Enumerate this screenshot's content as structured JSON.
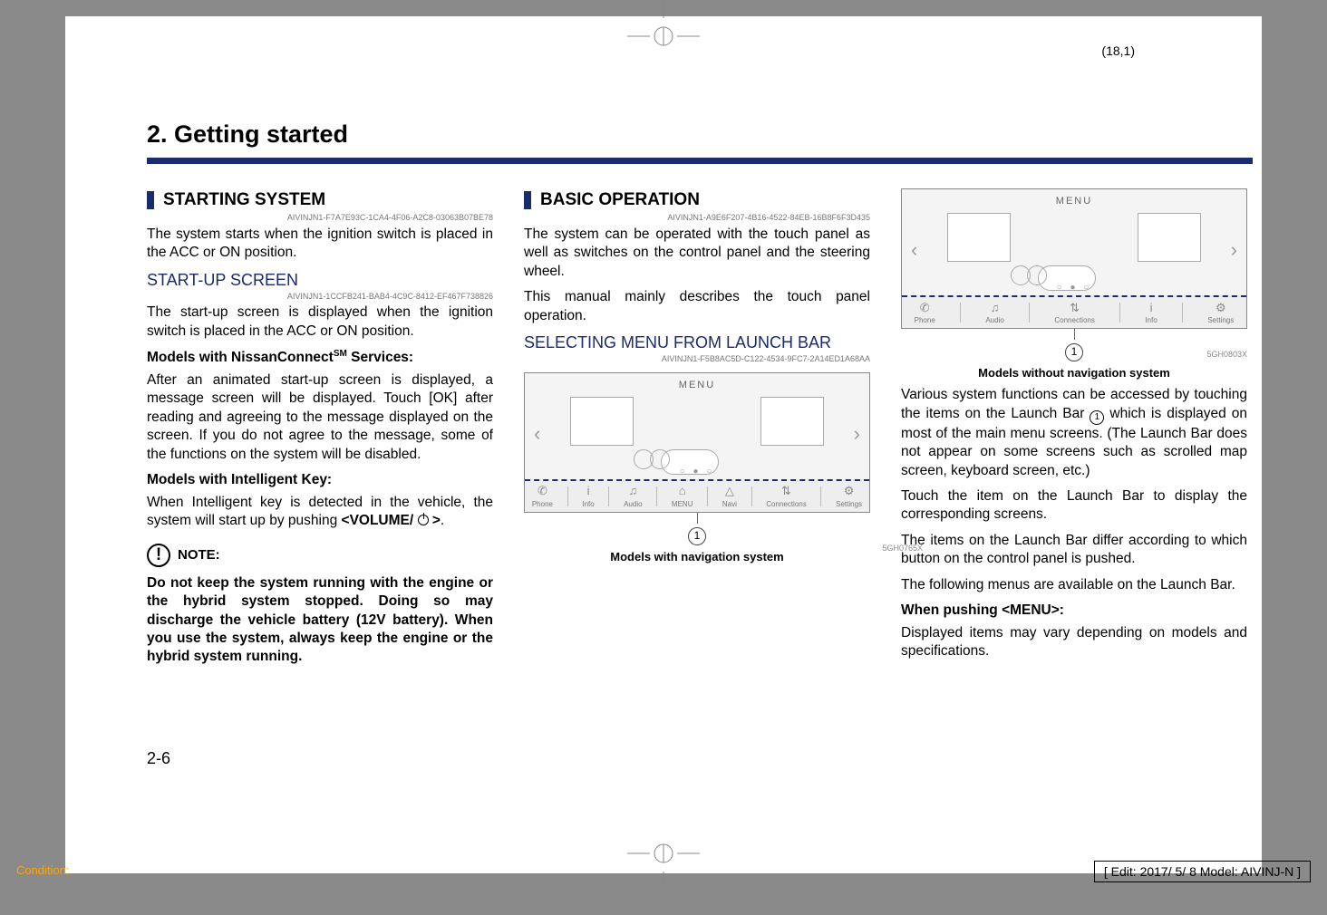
{
  "top_coord": "(18,1)",
  "chapter_title": "2. Getting started",
  "page_number": "2-6",
  "footer_condition": "Condition:",
  "footer_edit": "[ Edit: 2017/ 5/ 8   Model: AIVINJ-N ]",
  "col1": {
    "section_title": "STARTING SYSTEM",
    "code1": "AIVINJN1-F7A7E93C-1CA4-4F06-A2C8-03063B07BE78",
    "p1": "The system starts when the ignition switch is placed in the ACC or ON position.",
    "sub1": "START-UP SCREEN",
    "code2": "AIVINJN1-1CCFB241-BAB4-4C9C-8412-EF467F738826",
    "p2": "The start-up screen is displayed when the ignition switch is placed in the ACC or ON position.",
    "bold1_a": "Models with NissanConnect",
    "bold1_sm": "SM",
    "bold1_b": " Services:",
    "p3": "After an animated start-up screen is displayed, a message screen will be displayed. Touch [OK] after reading and agreeing to the message displayed on the screen. If you do not agree to the message, some of the functions on the system will be disabled.",
    "bold2": "Models with Intelligent Key:",
    "p4_a": "When Intelligent key is detected in the vehicle, the system will start up by pushing ",
    "p4_b": "<VOLUME/",
    "p4_c": ">",
    "p4_d": ".",
    "note_label": "NOTE:",
    "note_body": "Do not keep the system running with the engine or the hybrid system stopped. Doing so may discharge the vehicle battery (12V battery). When you use the system, always keep the engine or the hybrid system running."
  },
  "col2": {
    "section_title": "BASIC OPERATION",
    "code1": "AIVINJN1-A9E6F207-4B16-4522-84EB-16B8F6F3D435",
    "p1": "The system can be operated with the touch panel as well as switches on the control panel and the steering wheel.",
    "p2": "This manual mainly describes the touch panel operation.",
    "sub1": "SELECTING MENU FROM LAUNCH BAR",
    "code2": "AIVINJN1-F5B8AC5D-C122-4534-9FC7-2A14ED1A68AA",
    "figure_menu_text": "MENU",
    "figure_icons": [
      {
        "glyph": "✆",
        "label": "Phone"
      },
      {
        "glyph": "i",
        "label": "Info"
      },
      {
        "glyph": "♫",
        "label": "Audio"
      },
      {
        "glyph": "⌂",
        "label": "MENU"
      },
      {
        "glyph": "△",
        "label": "Navi"
      },
      {
        "glyph": "⇅",
        "label": "Connections"
      },
      {
        "glyph": "⚙",
        "label": "Settings"
      }
    ],
    "callout": "1",
    "figure_code": "5GH0765X",
    "caption": "Models with navigation system"
  },
  "col3": {
    "figure_menu_text": "MENU",
    "figure_icons": [
      {
        "glyph": "✆",
        "label": "Phone"
      },
      {
        "glyph": "♫",
        "label": "Audio"
      },
      {
        "glyph": "⇅",
        "label": "Connections"
      },
      {
        "glyph": "i",
        "label": "Info"
      },
      {
        "glyph": "⚙",
        "label": "Settings"
      }
    ],
    "callout": "1",
    "figure_code": "5GH0803X",
    "caption": "Models without navigation system",
    "p1_a": "Various system functions can be accessed by touching the items on the Launch Bar ",
    "p1_circ": "1",
    "p1_b": " which is displayed on most of the main menu screens. (The Launch Bar does not appear on some screens such as scrolled map screen, keyboard screen, etc.)",
    "p2": "Touch the item on the Launch Bar to display the corresponding screens.",
    "p3": "The items on the Launch Bar differ according to which button on the control panel is pushed.",
    "p4": "The following menus are available on the Launch Bar.",
    "bold1": "When pushing <MENU>:",
    "p5": "Displayed items may vary depending on models and specifications."
  }
}
